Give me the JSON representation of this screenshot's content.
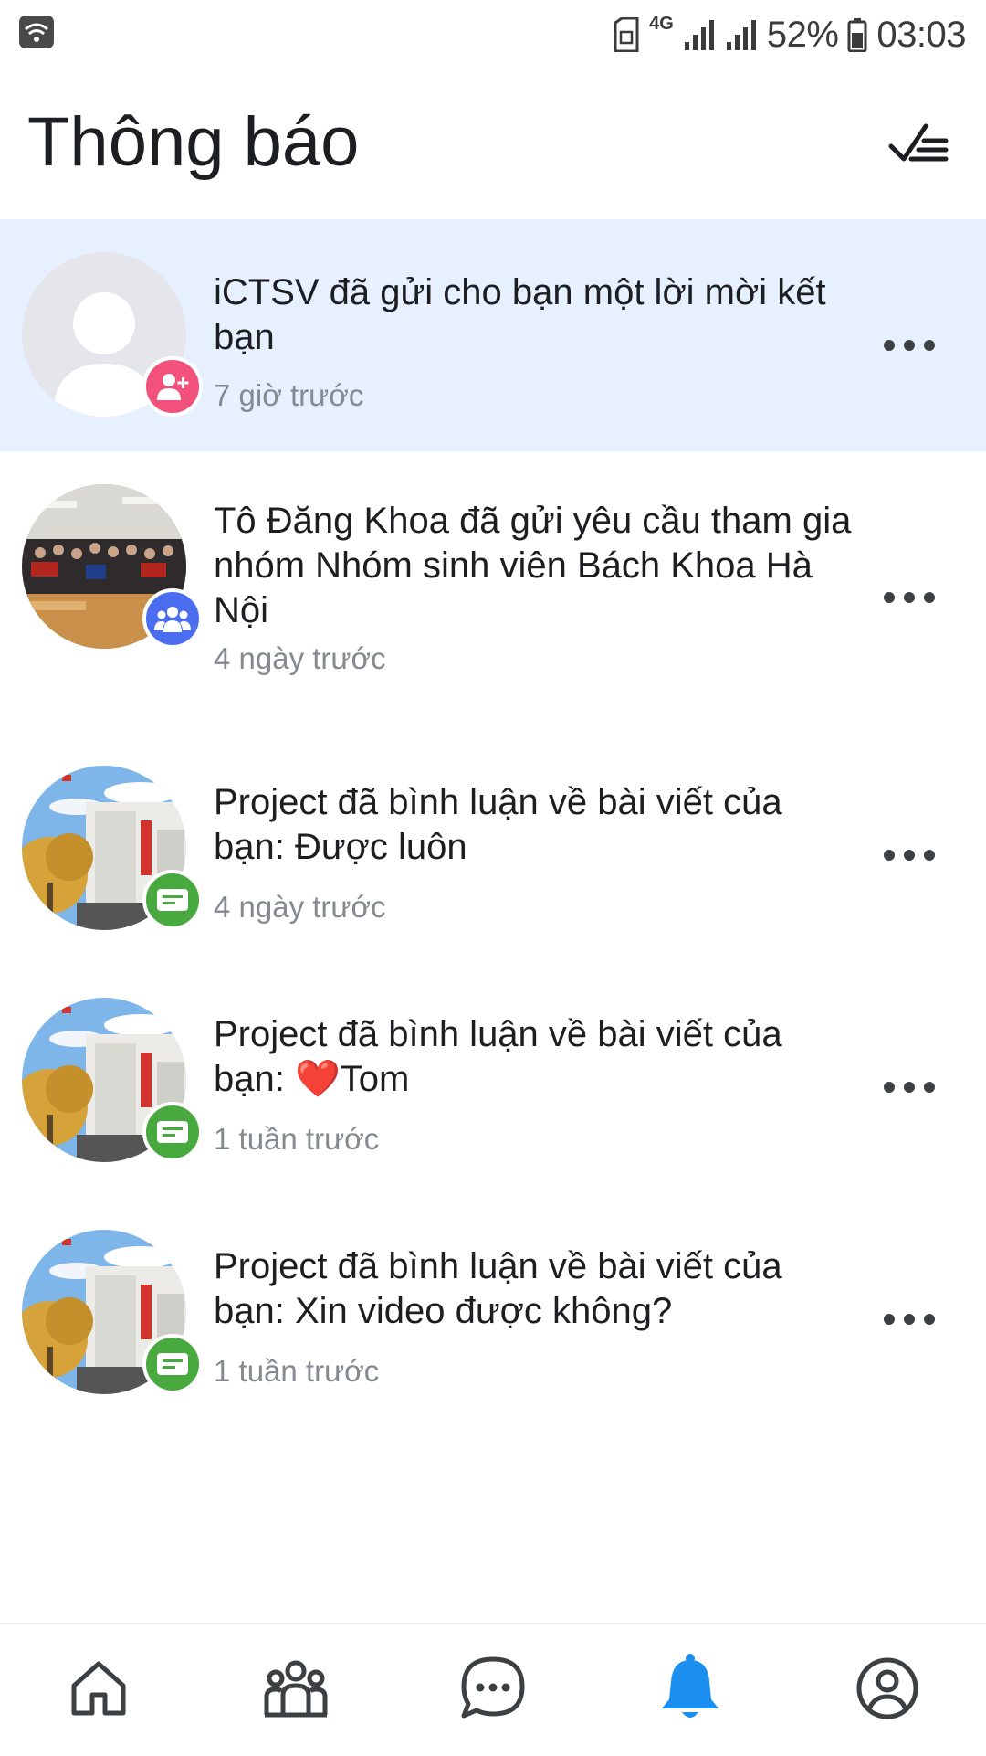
{
  "status_bar": {
    "network_label": "4G",
    "battery": "52%",
    "time": "03:03",
    "icons": [
      "wifi-icon",
      "sim-icon",
      "network-4g-icon",
      "signal-icon",
      "signal-icon",
      "battery-icon"
    ]
  },
  "header": {
    "title": "Thông báo",
    "action_icon": "mark-all-read-icon"
  },
  "notifications": [
    {
      "text": "iCTSV đã gửi cho bạn một lời mời kết bạn",
      "time": "7 giờ trước",
      "unread": true,
      "badge": "friend-request-icon",
      "badge_color": "#f1517b"
    },
    {
      "text": "Tô Đăng Khoa đã gửi yêu cầu tham gia nhóm Nhóm sinh viên Bách Khoa Hà Nội",
      "time": "4 ngày trước",
      "unread": false,
      "badge": "group-icon",
      "badge_color": "#4b6ef0"
    },
    {
      "text": "Project đã bình luận về bài viết của bạn: Được luôn",
      "time": "4 ngày trước",
      "unread": false,
      "badge": "comment-icon",
      "badge_color": "#47a93e"
    },
    {
      "text": "Project đã bình luận về bài viết của bạn: ❤️Tom",
      "time": "1 tuần trước",
      "unread": false,
      "badge": "comment-icon",
      "badge_color": "#47a93e"
    },
    {
      "text": "Project đã bình luận về bài viết của bạn: Xin video được không?",
      "time": "1 tuần trước",
      "unread": false,
      "badge": "comment-icon",
      "badge_color": "#47a93e"
    }
  ],
  "bottom_nav": {
    "items": [
      "home-icon",
      "friends-icon",
      "messages-icon",
      "notifications-icon",
      "profile-icon"
    ],
    "active": "notifications-icon",
    "active_color": "#1a8ff0"
  }
}
